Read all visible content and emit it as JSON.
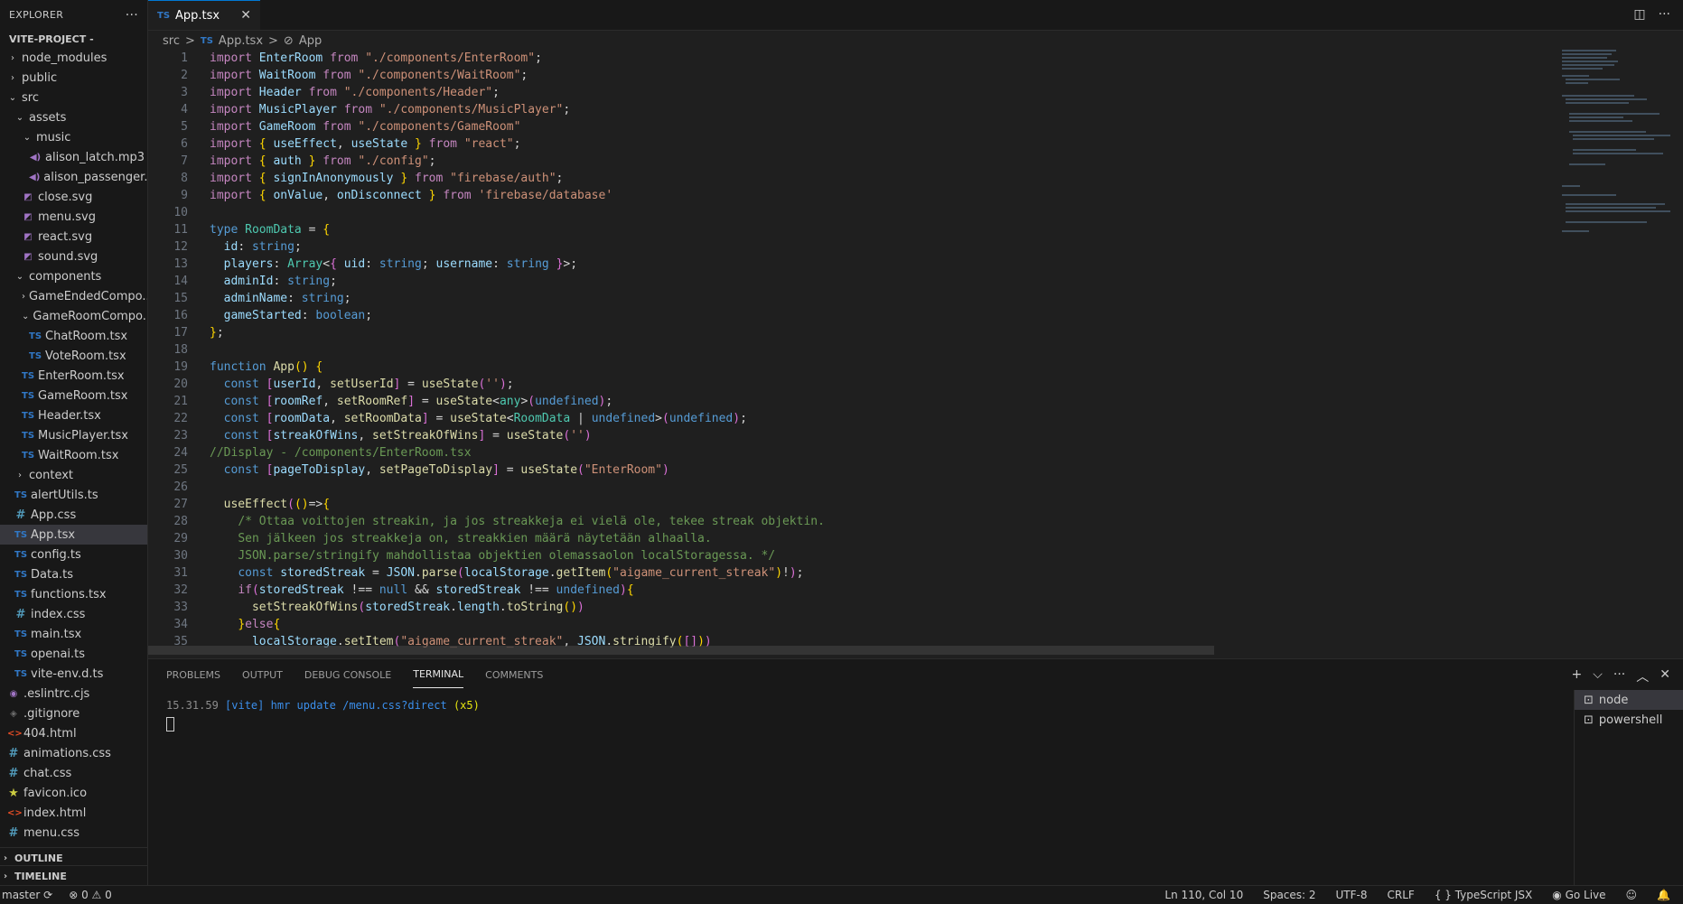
{
  "explorer": {
    "title": "EXPLORER",
    "more": "···",
    "project": "VITE-PROJECT -",
    "items": [
      {
        "label": "node_modules",
        "type": "folder",
        "indent": 0,
        "open": false
      },
      {
        "label": "public",
        "type": "folder",
        "indent": 0,
        "open": false
      },
      {
        "label": "src",
        "type": "folder",
        "indent": 0,
        "open": true
      },
      {
        "label": "assets",
        "type": "folder",
        "indent": 1,
        "open": true
      },
      {
        "label": "music",
        "type": "folder",
        "indent": 2,
        "open": true
      },
      {
        "label": "alison_latch.mp3",
        "type": "audio",
        "indent": 3
      },
      {
        "label": "alison_passenger....",
        "type": "audio",
        "indent": 3
      },
      {
        "label": "close.svg",
        "type": "svg",
        "indent": 2
      },
      {
        "label": "menu.svg",
        "type": "svg",
        "indent": 2
      },
      {
        "label": "react.svg",
        "type": "svg",
        "indent": 2
      },
      {
        "label": "sound.svg",
        "type": "svg",
        "indent": 2
      },
      {
        "label": "components",
        "type": "folder",
        "indent": 1,
        "open": true
      },
      {
        "label": "GameEndedCompo...",
        "type": "folder",
        "indent": 2,
        "open": false
      },
      {
        "label": "GameRoomCompo...",
        "type": "folder",
        "indent": 2,
        "open": true
      },
      {
        "label": "ChatRoom.tsx",
        "type": "ts",
        "indent": 3
      },
      {
        "label": "VoteRoom.tsx",
        "type": "ts",
        "indent": 3
      },
      {
        "label": "EnterRoom.tsx",
        "type": "ts",
        "indent": 2
      },
      {
        "label": "GameRoom.tsx",
        "type": "ts",
        "indent": 2
      },
      {
        "label": "Header.tsx",
        "type": "ts",
        "indent": 2
      },
      {
        "label": "MusicPlayer.tsx",
        "type": "ts",
        "indent": 2
      },
      {
        "label": "WaitRoom.tsx",
        "type": "ts",
        "indent": 2
      },
      {
        "label": "context",
        "type": "folder",
        "indent": 1,
        "open": false
      },
      {
        "label": "alertUtils.ts",
        "type": "ts",
        "indent": 1
      },
      {
        "label": "App.css",
        "type": "css",
        "indent": 1
      },
      {
        "label": "App.tsx",
        "type": "ts",
        "indent": 1,
        "active": true
      },
      {
        "label": "config.ts",
        "type": "ts",
        "indent": 1
      },
      {
        "label": "Data.ts",
        "type": "ts",
        "indent": 1
      },
      {
        "label": "functions.tsx",
        "type": "ts",
        "indent": 1
      },
      {
        "label": "index.css",
        "type": "css",
        "indent": 1
      },
      {
        "label": "main.tsx",
        "type": "ts",
        "indent": 1
      },
      {
        "label": "openai.ts",
        "type": "ts",
        "indent": 1
      },
      {
        "label": "vite-env.d.ts",
        "type": "ts",
        "indent": 1
      },
      {
        "label": ".eslintrc.cjs",
        "type": "eslint",
        "indent": 0
      },
      {
        "label": ".gitignore",
        "type": "git",
        "indent": 0
      },
      {
        "label": "404.html",
        "type": "html",
        "indent": 0
      },
      {
        "label": "animations.css",
        "type": "css",
        "indent": 0
      },
      {
        "label": "chat.css",
        "type": "css",
        "indent": 0
      },
      {
        "label": "favicon.ico",
        "type": "star",
        "indent": 0
      },
      {
        "label": "index.html",
        "type": "html",
        "indent": 0
      },
      {
        "label": "menu.css",
        "type": "css",
        "indent": 0
      }
    ],
    "outline": "OUTLINE",
    "timeline": "TIMELINE"
  },
  "icons": {
    "ts": "TS",
    "css": "#",
    "svg": "◩",
    "audio": "◀)",
    "html": "<>",
    "git": "◈",
    "star": "★",
    "eslint": "◉"
  },
  "editor": {
    "tab": {
      "label": "App.tsx",
      "ts": "TS",
      "close": "✕"
    },
    "actions": {
      "split": "◫",
      "more": "···"
    },
    "breadcrumb": {
      "src": "src",
      "sep": ">",
      "file": "App.tsx",
      "symbol": "App",
      "ts": "TS",
      "symbol_icon": "⊘"
    },
    "lines": [
      [
        [
          "kw",
          "import "
        ],
        [
          "var",
          "EnterRoom "
        ],
        [
          "kw",
          "from "
        ],
        [
          "str",
          "\"./components/EnterRoom\""
        ],
        [
          "src",
          ";"
        ]
      ],
      [
        [
          "kw",
          "import "
        ],
        [
          "var",
          "WaitRoom "
        ],
        [
          "kw",
          "from "
        ],
        [
          "str",
          "\"./components/WaitRoom\""
        ],
        [
          "src",
          ";"
        ]
      ],
      [
        [
          "kw",
          "import "
        ],
        [
          "var",
          "Header "
        ],
        [
          "kw",
          "from "
        ],
        [
          "str",
          "\"./components/Header\""
        ],
        [
          "src",
          ";"
        ]
      ],
      [
        [
          "kw",
          "import "
        ],
        [
          "var",
          "MusicPlayer "
        ],
        [
          "kw",
          "from "
        ],
        [
          "str",
          "\"./components/MusicPlayer\""
        ],
        [
          "src",
          ";"
        ]
      ],
      [
        [
          "kw",
          "import "
        ],
        [
          "var",
          "GameRoom "
        ],
        [
          "kw",
          "from "
        ],
        [
          "str",
          "\"./components/GameRoom\""
        ]
      ],
      [
        [
          "kw",
          "import "
        ],
        [
          "br",
          "{ "
        ],
        [
          "var",
          "useEffect"
        ],
        [
          "src",
          ", "
        ],
        [
          "var",
          "useState "
        ],
        [
          "br",
          "} "
        ],
        [
          "kw",
          "from "
        ],
        [
          "str",
          "\"react\""
        ],
        [
          "src",
          ";"
        ]
      ],
      [
        [
          "kw",
          "import "
        ],
        [
          "br",
          "{ "
        ],
        [
          "var",
          "auth "
        ],
        [
          "br",
          "} "
        ],
        [
          "kw",
          "from "
        ],
        [
          "str",
          "\"./config\""
        ],
        [
          "src",
          ";"
        ]
      ],
      [
        [
          "kw",
          "import "
        ],
        [
          "br",
          "{ "
        ],
        [
          "var",
          "signInAnonymously "
        ],
        [
          "br",
          "} "
        ],
        [
          "kw",
          "from "
        ],
        [
          "str",
          "\"firebase/auth\""
        ],
        [
          "src",
          ";"
        ]
      ],
      [
        [
          "kw",
          "import "
        ],
        [
          "br",
          "{ "
        ],
        [
          "var",
          "onValue"
        ],
        [
          "src",
          ", "
        ],
        [
          "var",
          "onDisconnect "
        ],
        [
          "br",
          "} "
        ],
        [
          "kw",
          "from "
        ],
        [
          "str",
          "'firebase/database'"
        ]
      ],
      [],
      [
        [
          "ty",
          "type "
        ],
        [
          "cls",
          "RoomData "
        ],
        [
          "src",
          "= "
        ],
        [
          "br",
          "{"
        ]
      ],
      [
        [
          "src",
          "  "
        ],
        [
          "var",
          "id"
        ],
        [
          "src",
          ": "
        ],
        [
          "ty",
          "string"
        ],
        [
          "src",
          ";"
        ]
      ],
      [
        [
          "src",
          "  "
        ],
        [
          "var",
          "players"
        ],
        [
          "src",
          ": "
        ],
        [
          "cls",
          "Array"
        ],
        [
          "src",
          "<"
        ],
        [
          "br2",
          "{ "
        ],
        [
          "var",
          "uid"
        ],
        [
          "src",
          ": "
        ],
        [
          "ty",
          "string"
        ],
        [
          "src",
          "; "
        ],
        [
          "var",
          "username"
        ],
        [
          "src",
          ": "
        ],
        [
          "ty",
          "string "
        ],
        [
          "br2",
          "}"
        ],
        [
          "src",
          ">;"
        ]
      ],
      [
        [
          "src",
          "  "
        ],
        [
          "var",
          "adminId"
        ],
        [
          "src",
          ": "
        ],
        [
          "ty",
          "string"
        ],
        [
          "src",
          ";"
        ]
      ],
      [
        [
          "src",
          "  "
        ],
        [
          "var",
          "adminName"
        ],
        [
          "src",
          ": "
        ],
        [
          "ty",
          "string"
        ],
        [
          "src",
          ";"
        ]
      ],
      [
        [
          "src",
          "  "
        ],
        [
          "var",
          "gameStarted"
        ],
        [
          "src",
          ": "
        ],
        [
          "ty",
          "boolean"
        ],
        [
          "src",
          ";"
        ]
      ],
      [
        [
          "br",
          "}"
        ],
        [
          "src",
          ";"
        ]
      ],
      [],
      [
        [
          "ty",
          "function "
        ],
        [
          "fn",
          "App"
        ],
        [
          "br",
          "() {"
        ]
      ],
      [
        [
          "src",
          "  "
        ],
        [
          "ty",
          "const "
        ],
        [
          "br2",
          "["
        ],
        [
          "var",
          "userId"
        ],
        [
          "src",
          ", "
        ],
        [
          "fn",
          "setUserId"
        ],
        [
          "br2",
          "]"
        ],
        [
          "src",
          " = "
        ],
        [
          "fn",
          "useState"
        ],
        [
          "br2",
          "("
        ],
        [
          "str",
          "''"
        ],
        [
          "br2",
          ")"
        ],
        [
          "src",
          ";"
        ]
      ],
      [
        [
          "src",
          "  "
        ],
        [
          "ty",
          "const "
        ],
        [
          "br2",
          "["
        ],
        [
          "var",
          "roomRef"
        ],
        [
          "src",
          ", "
        ],
        [
          "fn",
          "setRoomRef"
        ],
        [
          "br2",
          "]"
        ],
        [
          "src",
          " = "
        ],
        [
          "fn",
          "useState"
        ],
        [
          "src",
          "<"
        ],
        [
          "cls",
          "any"
        ],
        [
          "src",
          ">"
        ],
        [
          "br2",
          "("
        ],
        [
          "ty",
          "undefined"
        ],
        [
          "br2",
          ")"
        ],
        [
          "src",
          ";"
        ]
      ],
      [
        [
          "src",
          "  "
        ],
        [
          "ty",
          "const "
        ],
        [
          "br2",
          "["
        ],
        [
          "var",
          "roomData"
        ],
        [
          "src",
          ", "
        ],
        [
          "fn",
          "setRoomData"
        ],
        [
          "br2",
          "]"
        ],
        [
          "src",
          " = "
        ],
        [
          "fn",
          "useState"
        ],
        [
          "src",
          "<"
        ],
        [
          "cls",
          "RoomData "
        ],
        [
          "src",
          "| "
        ],
        [
          "ty",
          "undefined"
        ],
        [
          "src",
          ">"
        ],
        [
          "br2",
          "("
        ],
        [
          "ty",
          "undefined"
        ],
        [
          "br2",
          ")"
        ],
        [
          "src",
          ";"
        ]
      ],
      [
        [
          "src",
          "  "
        ],
        [
          "ty",
          "const "
        ],
        [
          "br2",
          "["
        ],
        [
          "var",
          "streakOfWins"
        ],
        [
          "src",
          ", "
        ],
        [
          "fn",
          "setStreakOfWins"
        ],
        [
          "br2",
          "]"
        ],
        [
          "src",
          " = "
        ],
        [
          "fn",
          "useState"
        ],
        [
          "br2",
          "("
        ],
        [
          "str",
          "''"
        ],
        [
          "br2",
          ")"
        ]
      ],
      [
        [
          "cm",
          "//Display - /components/EnterRoom.tsx"
        ]
      ],
      [
        [
          "src",
          "  "
        ],
        [
          "ty",
          "const "
        ],
        [
          "br2",
          "["
        ],
        [
          "var",
          "pageToDisplay"
        ],
        [
          "src",
          ", "
        ],
        [
          "fn",
          "setPageToDisplay"
        ],
        [
          "br2",
          "]"
        ],
        [
          "src",
          " = "
        ],
        [
          "fn",
          "useState"
        ],
        [
          "br2",
          "("
        ],
        [
          "str",
          "\"EnterRoom\""
        ],
        [
          "br2",
          ")"
        ]
      ],
      [],
      [
        [
          "src",
          "  "
        ],
        [
          "fn",
          "useEffect"
        ],
        [
          "br2",
          "("
        ],
        [
          "br",
          "()"
        ],
        [
          "src",
          "=>"
        ],
        [
          "br",
          "{"
        ]
      ],
      [
        [
          "src",
          "    "
        ],
        [
          "cm",
          "/* Ottaa voittojen streakin, ja jos streakkeja ei vielä ole, tekee streak objektin."
        ]
      ],
      [
        [
          "src",
          "    "
        ],
        [
          "cm",
          "Sen jälkeen jos streakkeja on, streakkien määrä näytetään alhaalla."
        ]
      ],
      [
        [
          "src",
          "    "
        ],
        [
          "cm",
          "JSON.parse/stringify mahdollistaa objektien olemassaolon localStoragessa. */"
        ]
      ],
      [
        [
          "src",
          "    "
        ],
        [
          "ty",
          "const "
        ],
        [
          "var",
          "storedStreak "
        ],
        [
          "src",
          "= "
        ],
        [
          "var",
          "JSON"
        ],
        [
          "src",
          "."
        ],
        [
          "fn",
          "parse"
        ],
        [
          "br2",
          "("
        ],
        [
          "var",
          "localStorage"
        ],
        [
          "src",
          "."
        ],
        [
          "fn",
          "getItem"
        ],
        [
          "br",
          "("
        ],
        [
          "str",
          "\"aigame_current_streak\""
        ],
        [
          "br",
          ")"
        ],
        [
          "src",
          "!"
        ],
        [
          "br2",
          ")"
        ],
        [
          "src",
          ";"
        ]
      ],
      [
        [
          "src",
          "    "
        ],
        [
          "kw",
          "if"
        ],
        [
          "br2",
          "("
        ],
        [
          "var",
          "storedStreak "
        ],
        [
          "src",
          "!== "
        ],
        [
          "ty",
          "null "
        ],
        [
          "src",
          "&& "
        ],
        [
          "var",
          "storedStreak "
        ],
        [
          "src",
          "!== "
        ],
        [
          "ty",
          "undefined"
        ],
        [
          "br2",
          ")"
        ],
        [
          "br",
          "{"
        ]
      ],
      [
        [
          "src",
          "      "
        ],
        [
          "fn",
          "setStreakOfWins"
        ],
        [
          "br2",
          "("
        ],
        [
          "var",
          "storedStreak"
        ],
        [
          "src",
          "."
        ],
        [
          "var",
          "length"
        ],
        [
          "src",
          "."
        ],
        [
          "fn",
          "toString"
        ],
        [
          "br",
          "()"
        ],
        [
          "br2",
          ")"
        ]
      ],
      [
        [
          "src",
          "    "
        ],
        [
          "br",
          "}"
        ],
        [
          "kw",
          "else"
        ],
        [
          "br",
          "{"
        ]
      ],
      [
        [
          "src",
          "      "
        ],
        [
          "var",
          "localStorage"
        ],
        [
          "src",
          "."
        ],
        [
          "fn",
          "setItem"
        ],
        [
          "br2",
          "("
        ],
        [
          "str",
          "\"aigame_current_streak\""
        ],
        [
          "src",
          ", "
        ],
        [
          "var",
          "JSON"
        ],
        [
          "src",
          "."
        ],
        [
          "fn",
          "stringify"
        ],
        [
          "br",
          "("
        ],
        [
          "br2",
          "[]"
        ],
        [
          "br",
          ")"
        ],
        [
          "br2",
          ")"
        ]
      ]
    ]
  },
  "panel": {
    "tabs": [
      "PROBLEMS",
      "OUTPUT",
      "DEBUG CONSOLE",
      "TERMINAL",
      "COMMENTS"
    ],
    "active_tab": "TERMINAL",
    "actions": {
      "add": "+",
      "dropdown": "⌵",
      "more": "···",
      "maximize": "︿",
      "close": "✕"
    },
    "terminal": {
      "time": "15.31.59",
      "tag": "[vite]",
      "msg": "hmr update /menu.css?direct",
      "count": "(x5)"
    },
    "terminals": [
      {
        "label": "node",
        "active": true
      },
      {
        "label": "powershell",
        "active": false
      }
    ],
    "terminal_icon": "⊡"
  },
  "status": {
    "branch": "master",
    "sync": "⟳",
    "errors": "⊗ 0 ⚠ 0",
    "position": "Ln 110, Col 10",
    "spaces": "Spaces: 2",
    "encoding": "UTF-8",
    "eol": "CRLF",
    "language": "{ } TypeScript JSX",
    "golive": "◉ Go Live",
    "feedback": "☺",
    "bell": "🔔"
  }
}
